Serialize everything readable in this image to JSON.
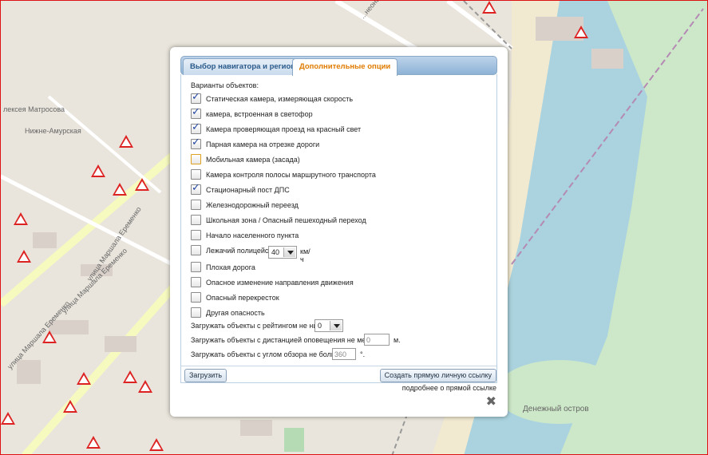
{
  "map": {
    "labels": {
      "street_top": "...неонская улица",
      "matrosova": "лексея Матросова",
      "nizhne_amurskaya": "Нижне-Амурская",
      "eremenko_1": "улица Маршала Еременко",
      "eremenko_2": "улица Маршала Еременко",
      "eremenko_3": "улица Маршала Еременко",
      "island": "Денежный остров"
    }
  },
  "dialog": {
    "tabs": {
      "region": "Выбор навигатора и региона",
      "options": "Дополнительные опции"
    },
    "heading": "Варианты объектов:",
    "options": [
      {
        "label": "Статическая камера, измеряющая скорость",
        "checked": true
      },
      {
        "label": "камера, встроенная в светофор",
        "checked": true
      },
      {
        "label": "Камера проверяющая проезд на красный свет",
        "checked": true
      },
      {
        "label": "Парная камера на отрезке дороги",
        "checked": true
      },
      {
        "label": "Мобильная камера (засада)",
        "checked": false
      },
      {
        "label": "Камера контроля полосы маршрутного транспорта",
        "checked": false
      },
      {
        "label": "Стационарный пост ДПС",
        "checked": true
      },
      {
        "label": "Железнодорожный переезд",
        "checked": false
      },
      {
        "label": "Школьная зона / Опасный пешеходный переход",
        "checked": false
      },
      {
        "label": "Начало населенного пункта",
        "checked": false
      },
      {
        "label": "Лежачий полицейский",
        "checked": false
      },
      {
        "label": "Плохая дорога",
        "checked": false
      },
      {
        "label": "Опасное изменение направления движения",
        "checked": false
      },
      {
        "label": "Опасный перекресток",
        "checked": false
      },
      {
        "label": "Другая опасность",
        "checked": false
      }
    ],
    "speed_bump": {
      "value": "40",
      "unit": "км/ч"
    },
    "rating": {
      "label": "Загружать объекты с рейтингом не ниже:",
      "value": "0"
    },
    "distance": {
      "label": "Загружать объекты с дистанцией оповещения не меньше:",
      "placeholder": "0",
      "unit": "м."
    },
    "angle": {
      "label": "Загружать объекты с углом обзора не больше:",
      "placeholder": "360",
      "unit": "°."
    },
    "buttons": {
      "load": "Загрузить",
      "create_link": "Создать прямую личную ссылку"
    },
    "more_link": "подробнее о прямой ссылке",
    "close_glyph": "✖"
  }
}
